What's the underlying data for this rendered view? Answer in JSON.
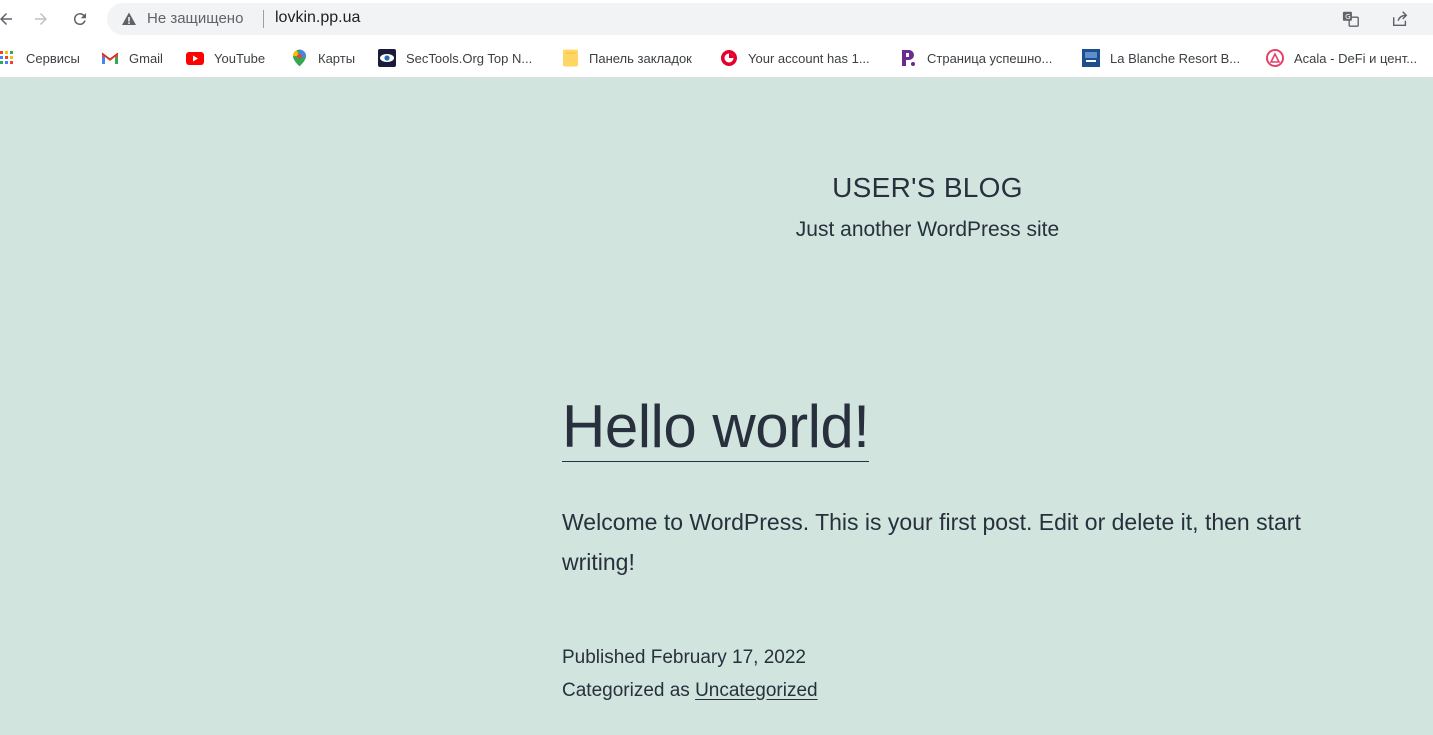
{
  "browser": {
    "security_label": "Не защищено",
    "url": "lovkin.pp.ua"
  },
  "bookmarks": [
    {
      "label": "Сервисы",
      "icon": "apps-grid-icon"
    },
    {
      "label": "Gmail",
      "icon": "gmail-icon"
    },
    {
      "label": "YouTube",
      "icon": "youtube-icon"
    },
    {
      "label": "Карты",
      "icon": "maps-pin-icon"
    },
    {
      "label": "SecTools.Org Top N...",
      "icon": "sectools-eye-icon"
    },
    {
      "label": "Панель закладок",
      "icon": "folder-icon"
    },
    {
      "label": "Your account has 1...",
      "icon": "red-circle-icon"
    },
    {
      "label": "Страница успешно...",
      "icon": "purple-p-icon"
    },
    {
      "label": "La Blanche Resort B...",
      "icon": "resort-icon"
    },
    {
      "label": "Acala - DeFi и цент...",
      "icon": "acala-icon"
    }
  ],
  "site": {
    "title": "USER'S BLOG",
    "tagline": "Just another WordPress site"
  },
  "post": {
    "title": "Hello world!",
    "body": "Welcome to WordPress. This is your first post. Edit or delete it, then start writing!",
    "published": "Published February 17, 2022",
    "categorized_prefix": "Categorized as ",
    "category": "Uncategorized"
  },
  "colors": {
    "page_background": "#d1e4dd",
    "text": "#28303d"
  }
}
